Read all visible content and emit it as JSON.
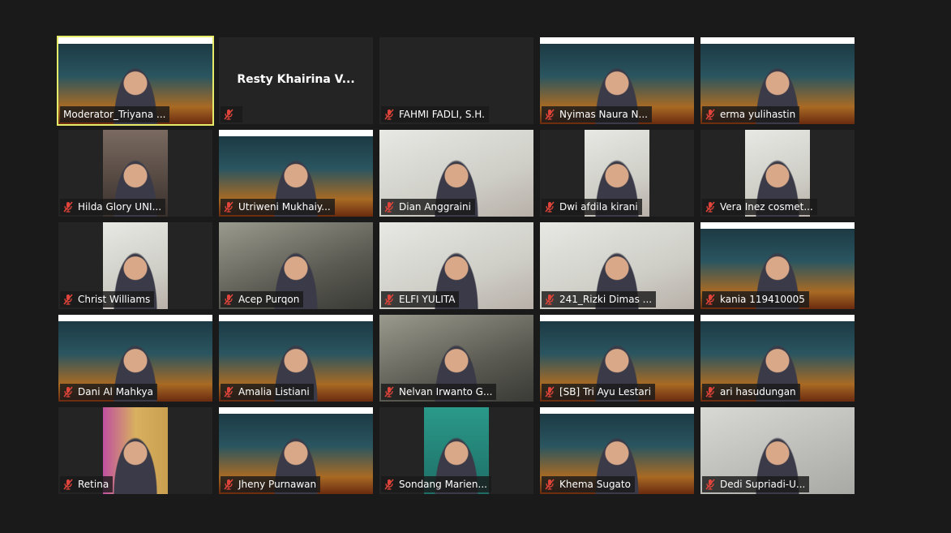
{
  "accent_active_speaker": "#e6ec6a",
  "muted_icon_color": "#e0443a",
  "participants": [
    {
      "name": "Moderator_Triyana ...",
      "muted": false,
      "video": "slide",
      "active": true
    },
    {
      "name": "Resty Khairina V...",
      "muted": true,
      "video": "off",
      "show_center_name": true
    },
    {
      "name": "FAHMI FADLI, S.H.",
      "muted": true,
      "video": "off"
    },
    {
      "name": "Nyimas Naura N...",
      "muted": true,
      "video": "slide"
    },
    {
      "name": "erma yulihastin",
      "muted": true,
      "video": "slide"
    },
    {
      "name": "Hilda Glory UNI...",
      "muted": true,
      "video": "portrait"
    },
    {
      "name": "Utriweni Mukhaiy...",
      "muted": true,
      "video": "slide"
    },
    {
      "name": "Dian Anggraini",
      "muted": true,
      "video": "light"
    },
    {
      "name": "Dwi afdila kirani",
      "muted": true,
      "video": "portrait-light"
    },
    {
      "name": "Vera Inez cosmet...",
      "muted": true,
      "video": "portrait-light"
    },
    {
      "name": "Christ Williams",
      "muted": true,
      "video": "portrait-light"
    },
    {
      "name": "Acep Purqon",
      "muted": true,
      "video": "camera"
    },
    {
      "name": "ELFI YULITA",
      "muted": true,
      "video": "light"
    },
    {
      "name": "241_Rizki Dimas ...",
      "muted": true,
      "video": "light"
    },
    {
      "name": "kania 119410005",
      "muted": true,
      "video": "slide"
    },
    {
      "name": "Dani Al Mahkya",
      "muted": true,
      "video": "slide"
    },
    {
      "name": "Amalia Listiani",
      "muted": true,
      "video": "slide"
    },
    {
      "name": "Nelvan Irwanto G...",
      "muted": true,
      "video": "camera"
    },
    {
      "name": "[SB] Tri Ayu Lestari",
      "muted": true,
      "video": "slide"
    },
    {
      "name": "ari hasudungan",
      "muted": true,
      "video": "slide"
    },
    {
      "name": "Retina",
      "muted": true,
      "video": "portrait-pink"
    },
    {
      "name": "Jheny Purnawan",
      "muted": true,
      "video": "slide"
    },
    {
      "name": "Sondang Marien...",
      "muted": true,
      "video": "portrait-teal"
    },
    {
      "name": "Khema Sugato",
      "muted": true,
      "video": "slide"
    },
    {
      "name": "Dedi Supriadi-U...",
      "muted": true,
      "video": "grey"
    }
  ]
}
